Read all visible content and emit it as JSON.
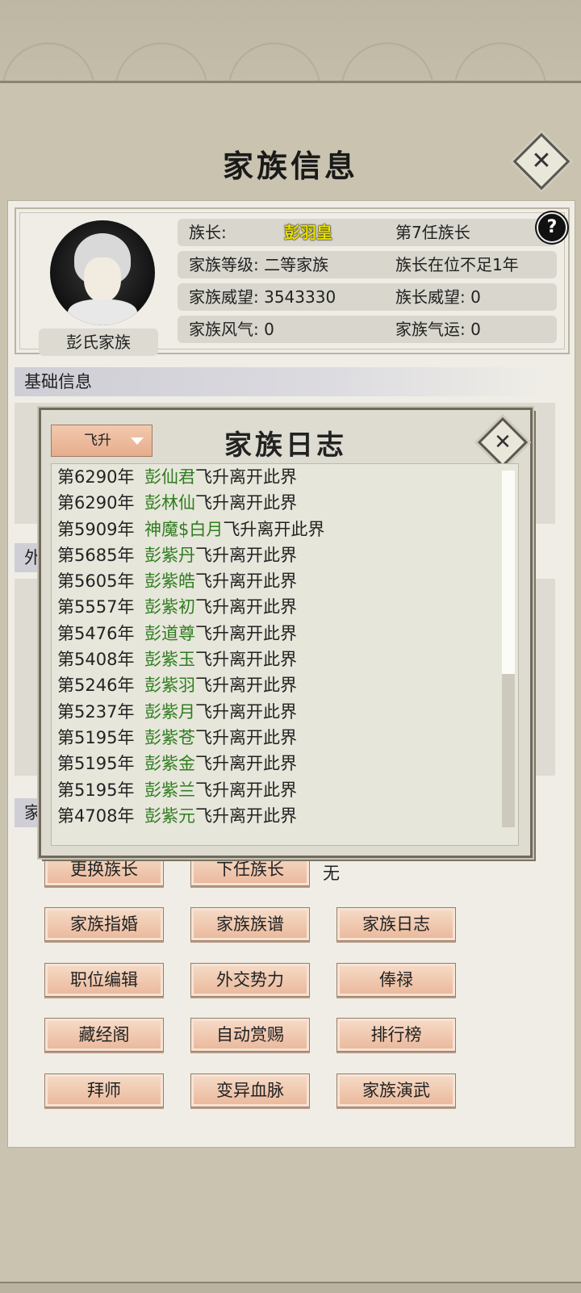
{
  "page_title": "家族信息",
  "close_icon": "✕",
  "help_icon": "?",
  "clan": {
    "name": "彭氏家族",
    "avatar_icon": "portrait-icon",
    "rows": [
      {
        "left_label": "族长:",
        "leader_name": "彭羽皇",
        "right": "第7任族长"
      },
      {
        "left": "家族等级: 二等家族",
        "right": "族长在位不足1年"
      },
      {
        "left": "家族威望: 3543330",
        "right": "族长威望: 0"
      },
      {
        "left": "家族风气: 0",
        "right": "家族气运: 0"
      }
    ]
  },
  "sections": {
    "basic_info": "基础信息",
    "foreign_partial": "外",
    "clan_partial": "家"
  },
  "buttons": {
    "change_leader": "更换族长",
    "next_leader": "下任族长",
    "next_leader_value": "无",
    "marriage": "家族指婚",
    "genealogy": "家族族谱",
    "clan_log": "家族日志",
    "position_edit": "职位编辑",
    "diplomacy": "外交势力",
    "salary": "俸禄",
    "scripture_pavilion": "藏经阁",
    "auto_reward": "自动赏赐",
    "ranking": "排行榜",
    "apprentice": "拜师",
    "mutation_bloodline": "变异血脉",
    "martial_show": "家族演武"
  },
  "log_dialog": {
    "title": "家族日志",
    "filter_value": "飞升",
    "filter_icon": "triangle-down-icon",
    "entries": [
      {
        "year": "第6290年",
        "name": "彭仙君",
        "text": "飞升离开此界"
      },
      {
        "year": "第6290年",
        "name": "彭林仙",
        "text": "飞升离开此界"
      },
      {
        "year": "第5909年",
        "name": "神魔$白月",
        "text": "飞升离开此界"
      },
      {
        "year": "第5685年",
        "name": "彭紫丹",
        "text": "飞升离开此界"
      },
      {
        "year": "第5605年",
        "name": "彭紫皓",
        "text": "飞升离开此界"
      },
      {
        "year": "第5557年",
        "name": "彭紫初",
        "text": "飞升离开此界"
      },
      {
        "year": "第5476年",
        "name": "彭道尊",
        "text": "飞升离开此界"
      },
      {
        "year": "第5408年",
        "name": "彭紫玉",
        "text": "飞升离开此界"
      },
      {
        "year": "第5246年",
        "name": "彭紫羽",
        "text": "飞升离开此界"
      },
      {
        "year": "第5237年",
        "name": "彭紫月",
        "text": "飞升离开此界"
      },
      {
        "year": "第5195年",
        "name": "彭紫苍",
        "text": "飞升离开此界"
      },
      {
        "year": "第5195年",
        "name": "彭紫金",
        "text": "飞升离开此界"
      },
      {
        "year": "第5195年",
        "name": "彭紫兰",
        "text": "飞升离开此界"
      },
      {
        "year": "第4708年",
        "name": "彭紫元",
        "text": "飞升离开此界"
      }
    ]
  }
}
